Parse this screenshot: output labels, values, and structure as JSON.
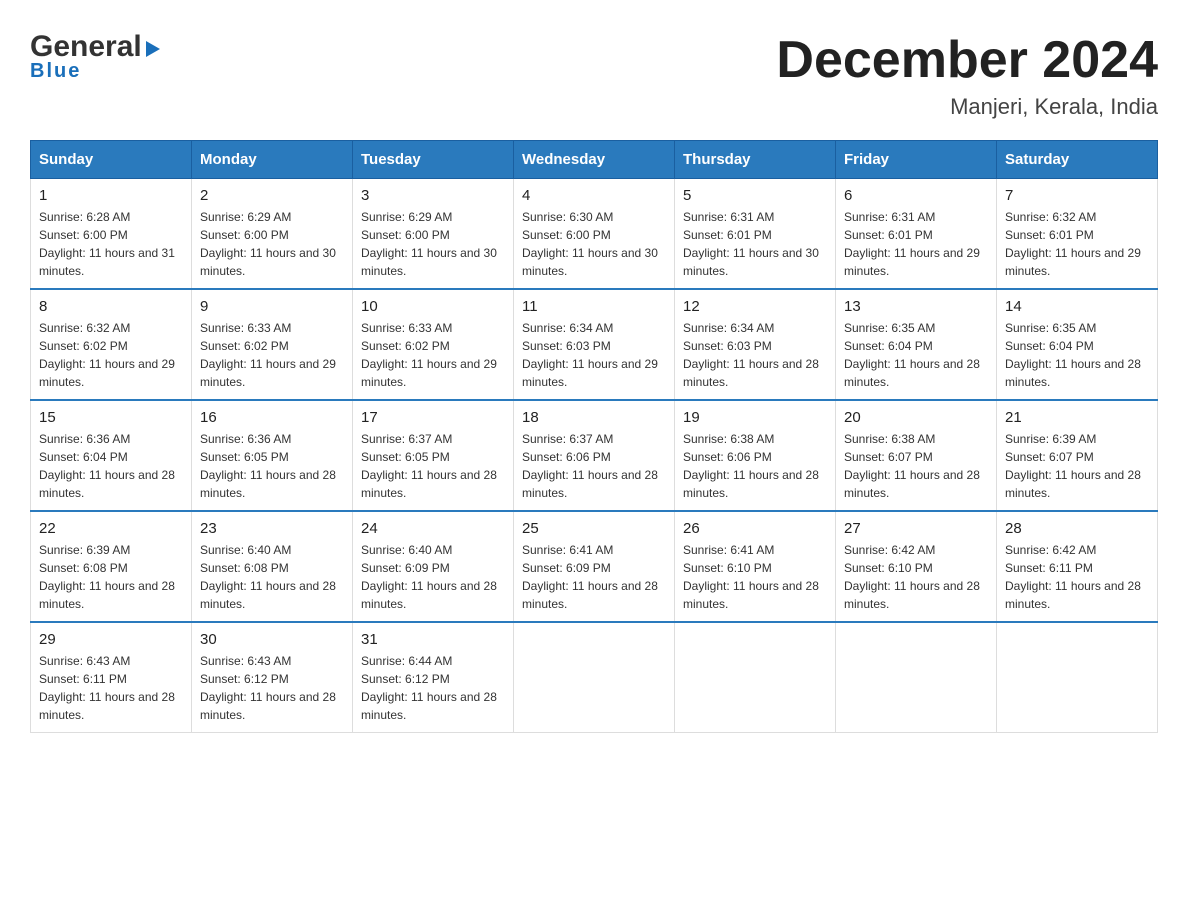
{
  "logo": {
    "general": "General",
    "blue": "Blue",
    "triangle": "▶"
  },
  "header": {
    "title": "December 2024",
    "subtitle": "Manjeri, Kerala, India"
  },
  "weekdays": [
    "Sunday",
    "Monday",
    "Tuesday",
    "Wednesday",
    "Thursday",
    "Friday",
    "Saturday"
  ],
  "weeks": [
    [
      {
        "day": "1",
        "sunrise": "6:28 AM",
        "sunset": "6:00 PM",
        "daylight": "11 hours and 31 minutes."
      },
      {
        "day": "2",
        "sunrise": "6:29 AM",
        "sunset": "6:00 PM",
        "daylight": "11 hours and 30 minutes."
      },
      {
        "day": "3",
        "sunrise": "6:29 AM",
        "sunset": "6:00 PM",
        "daylight": "11 hours and 30 minutes."
      },
      {
        "day": "4",
        "sunrise": "6:30 AM",
        "sunset": "6:00 PM",
        "daylight": "11 hours and 30 minutes."
      },
      {
        "day": "5",
        "sunrise": "6:31 AM",
        "sunset": "6:01 PM",
        "daylight": "11 hours and 30 minutes."
      },
      {
        "day": "6",
        "sunrise": "6:31 AM",
        "sunset": "6:01 PM",
        "daylight": "11 hours and 29 minutes."
      },
      {
        "day": "7",
        "sunrise": "6:32 AM",
        "sunset": "6:01 PM",
        "daylight": "11 hours and 29 minutes."
      }
    ],
    [
      {
        "day": "8",
        "sunrise": "6:32 AM",
        "sunset": "6:02 PM",
        "daylight": "11 hours and 29 minutes."
      },
      {
        "day": "9",
        "sunrise": "6:33 AM",
        "sunset": "6:02 PM",
        "daylight": "11 hours and 29 minutes."
      },
      {
        "day": "10",
        "sunrise": "6:33 AM",
        "sunset": "6:02 PM",
        "daylight": "11 hours and 29 minutes."
      },
      {
        "day": "11",
        "sunrise": "6:34 AM",
        "sunset": "6:03 PM",
        "daylight": "11 hours and 29 minutes."
      },
      {
        "day": "12",
        "sunrise": "6:34 AM",
        "sunset": "6:03 PM",
        "daylight": "11 hours and 28 minutes."
      },
      {
        "day": "13",
        "sunrise": "6:35 AM",
        "sunset": "6:04 PM",
        "daylight": "11 hours and 28 minutes."
      },
      {
        "day": "14",
        "sunrise": "6:35 AM",
        "sunset": "6:04 PM",
        "daylight": "11 hours and 28 minutes."
      }
    ],
    [
      {
        "day": "15",
        "sunrise": "6:36 AM",
        "sunset": "6:04 PM",
        "daylight": "11 hours and 28 minutes."
      },
      {
        "day": "16",
        "sunrise": "6:36 AM",
        "sunset": "6:05 PM",
        "daylight": "11 hours and 28 minutes."
      },
      {
        "day": "17",
        "sunrise": "6:37 AM",
        "sunset": "6:05 PM",
        "daylight": "11 hours and 28 minutes."
      },
      {
        "day": "18",
        "sunrise": "6:37 AM",
        "sunset": "6:06 PM",
        "daylight": "11 hours and 28 minutes."
      },
      {
        "day": "19",
        "sunrise": "6:38 AM",
        "sunset": "6:06 PM",
        "daylight": "11 hours and 28 minutes."
      },
      {
        "day": "20",
        "sunrise": "6:38 AM",
        "sunset": "6:07 PM",
        "daylight": "11 hours and 28 minutes."
      },
      {
        "day": "21",
        "sunrise": "6:39 AM",
        "sunset": "6:07 PM",
        "daylight": "11 hours and 28 minutes."
      }
    ],
    [
      {
        "day": "22",
        "sunrise": "6:39 AM",
        "sunset": "6:08 PM",
        "daylight": "11 hours and 28 minutes."
      },
      {
        "day": "23",
        "sunrise": "6:40 AM",
        "sunset": "6:08 PM",
        "daylight": "11 hours and 28 minutes."
      },
      {
        "day": "24",
        "sunrise": "6:40 AM",
        "sunset": "6:09 PM",
        "daylight": "11 hours and 28 minutes."
      },
      {
        "day": "25",
        "sunrise": "6:41 AM",
        "sunset": "6:09 PM",
        "daylight": "11 hours and 28 minutes."
      },
      {
        "day": "26",
        "sunrise": "6:41 AM",
        "sunset": "6:10 PM",
        "daylight": "11 hours and 28 minutes."
      },
      {
        "day": "27",
        "sunrise": "6:42 AM",
        "sunset": "6:10 PM",
        "daylight": "11 hours and 28 minutes."
      },
      {
        "day": "28",
        "sunrise": "6:42 AM",
        "sunset": "6:11 PM",
        "daylight": "11 hours and 28 minutes."
      }
    ],
    [
      {
        "day": "29",
        "sunrise": "6:43 AM",
        "sunset": "6:11 PM",
        "daylight": "11 hours and 28 minutes."
      },
      {
        "day": "30",
        "sunrise": "6:43 AM",
        "sunset": "6:12 PM",
        "daylight": "11 hours and 28 minutes."
      },
      {
        "day": "31",
        "sunrise": "6:44 AM",
        "sunset": "6:12 PM",
        "daylight": "11 hours and 28 minutes."
      },
      null,
      null,
      null,
      null
    ]
  ]
}
